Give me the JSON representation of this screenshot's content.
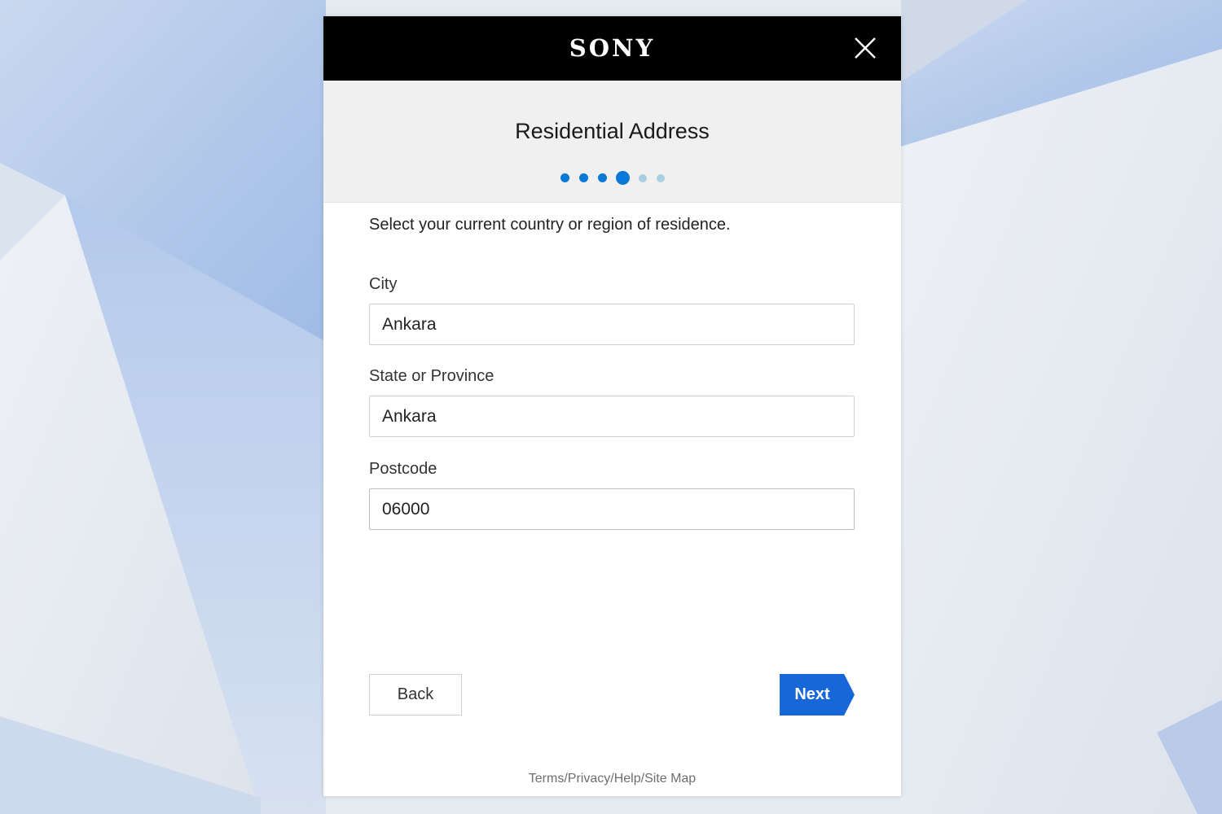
{
  "brand": {
    "logo_text": "SONY"
  },
  "header": {
    "title": "Residential Address",
    "steps_total": 6,
    "steps_current": 4
  },
  "form": {
    "intro": "Select your current country or region of residence.",
    "city": {
      "label": "City",
      "value": "Ankara"
    },
    "state": {
      "label": "State or Province",
      "value": "Ankara"
    },
    "postcode": {
      "label": "Postcode",
      "value": "06000"
    }
  },
  "actions": {
    "back_label": "Back",
    "next_label": "Next"
  },
  "footer": {
    "terms": "Terms",
    "privacy": "Privacy",
    "help": "Help",
    "sitemap": "Site Map",
    "separator": "/"
  },
  "colors": {
    "topbar": "#000000",
    "header_bg": "#f0f0f0",
    "accent": "#1767d8",
    "step_done": "#0a78d7",
    "step_todo": "#a9cfe3"
  },
  "icons": {
    "close": "close-icon"
  }
}
